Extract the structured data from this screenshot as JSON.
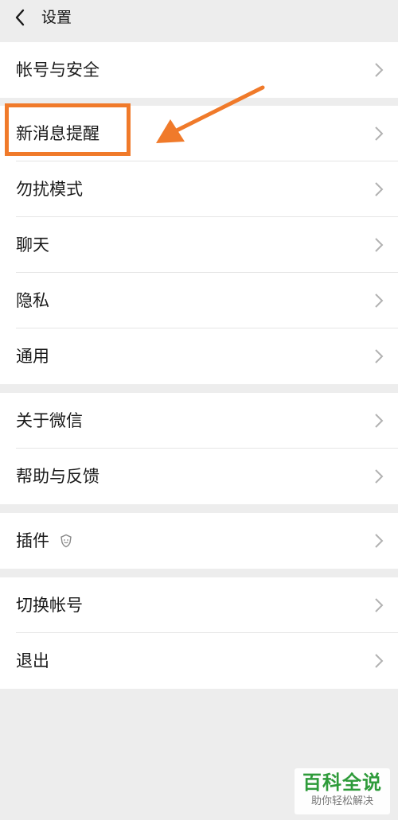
{
  "header": {
    "back_icon": "chevron-left-icon",
    "title": "设置"
  },
  "groups": [
    {
      "items": [
        {
          "label": "帐号与安全"
        }
      ]
    },
    {
      "items": [
        {
          "label": "新消息提醒"
        },
        {
          "label": "勿扰模式"
        },
        {
          "label": "聊天"
        },
        {
          "label": "隐私"
        },
        {
          "label": "通用"
        }
      ]
    },
    {
      "items": [
        {
          "label": "关于微信"
        },
        {
          "label": "帮助与反馈"
        }
      ]
    },
    {
      "items": [
        {
          "label": "插件",
          "icon": "plugin-icon"
        }
      ]
    },
    {
      "items": [
        {
          "label": "切换帐号"
        },
        {
          "label": "退出"
        }
      ]
    }
  ],
  "annotation": {
    "highlight_color": "#f07a2a",
    "highlighted_item": "新消息提醒"
  },
  "watermark": {
    "title": "百科全说",
    "subtitle": "助你轻松解决",
    "color": "#2e9b3a"
  },
  "colors": {
    "background": "#ededed",
    "card": "#ffffff",
    "divider": "#e5e5e5",
    "chevron": "#b2b2b2"
  }
}
